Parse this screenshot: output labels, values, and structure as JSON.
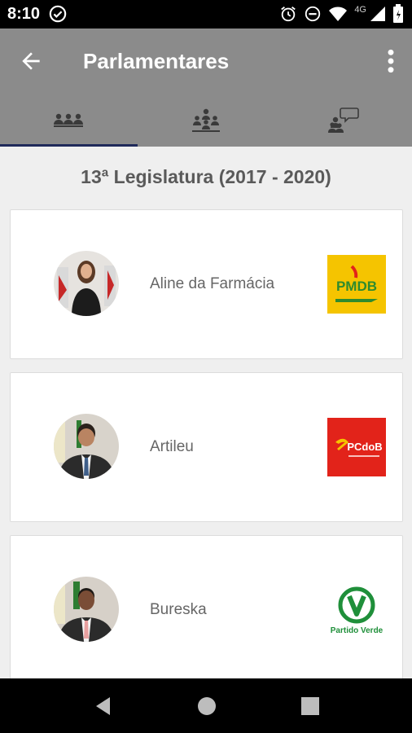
{
  "status_bar": {
    "time": "8:10",
    "network": "4G"
  },
  "app_bar": {
    "title": "Parlamentares"
  },
  "tabs": [
    {
      "icon": "group-icon",
      "active": true
    },
    {
      "icon": "assembly-icon",
      "active": false
    },
    {
      "icon": "discussion-icon",
      "active": false
    }
  ],
  "legislatura": "13ª Legislatura (2017 - 2020)",
  "parlamentares": [
    {
      "name": "Aline da Farmácia",
      "party_logo_text": "PMDB"
    },
    {
      "name": "Artileu",
      "party_logo_text": "PCdoB"
    },
    {
      "name": "Bureska",
      "party_logo_text": "Partido Verde"
    }
  ],
  "colors": {
    "app_bar": "#8b8b8b",
    "tab_indicator": "#202a5a",
    "background": "#efefef",
    "pmdb_yellow": "#f5c400",
    "pmdb_green": "#2e8b2e",
    "pcdob_red": "#e2231a",
    "pv_green": "#1f8f3a"
  }
}
